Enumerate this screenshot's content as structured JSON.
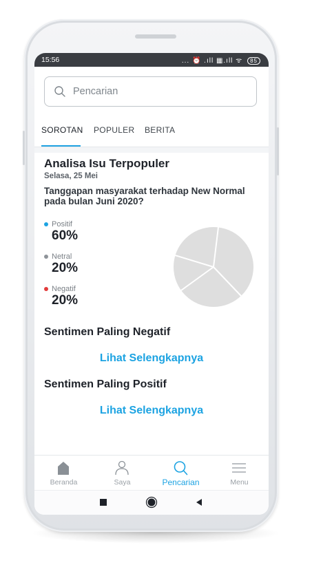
{
  "status_bar": {
    "time": "15:56",
    "indicators": "... ⏰ .ıll ▦.ıll ᯤ",
    "battery": "85"
  },
  "search": {
    "placeholder": "Pencarian"
  },
  "tabs": [
    {
      "label": "SOROTAN",
      "active": true
    },
    {
      "label": "POPULER",
      "active": false
    },
    {
      "label": "BERITA",
      "active": false
    }
  ],
  "analysis": {
    "title": "Analisa Isu Terpopuler",
    "date": "Selasa, 25 Mei",
    "question": "Tanggapan masyarakat terhadap New Normal pada bulan Juni 2020?",
    "legend": [
      {
        "label": "Positif",
        "value": "60%",
        "color": "#1ca3e2"
      },
      {
        "label": "Netral",
        "value": "20%",
        "color": "#8e9399"
      },
      {
        "label": "Negatif",
        "value": "20%",
        "color": "#e23b3b"
      }
    ],
    "pie_fill": "#dedede"
  },
  "sections": {
    "negative_title": "Sentimen Paling Negatif",
    "negative_link": "Lihat Selengkapnya",
    "positive_title": "Sentimen Paling Positif",
    "positive_link": "Lihat Selengkapnya"
  },
  "bottom_nav": [
    {
      "label": "Beranda",
      "icon": "home-icon",
      "active": false
    },
    {
      "label": "Saya",
      "icon": "user-icon",
      "active": false
    },
    {
      "label": "Pencarian",
      "icon": "search-icon",
      "active": true
    },
    {
      "label": "Menu",
      "icon": "menu-icon",
      "active": false
    }
  ],
  "system_nav": [
    "recents-button",
    "home-button",
    "back-button"
  ],
  "colors": {
    "accent": "#1ca3e2",
    "status_bar": "#3a3d42"
  }
}
